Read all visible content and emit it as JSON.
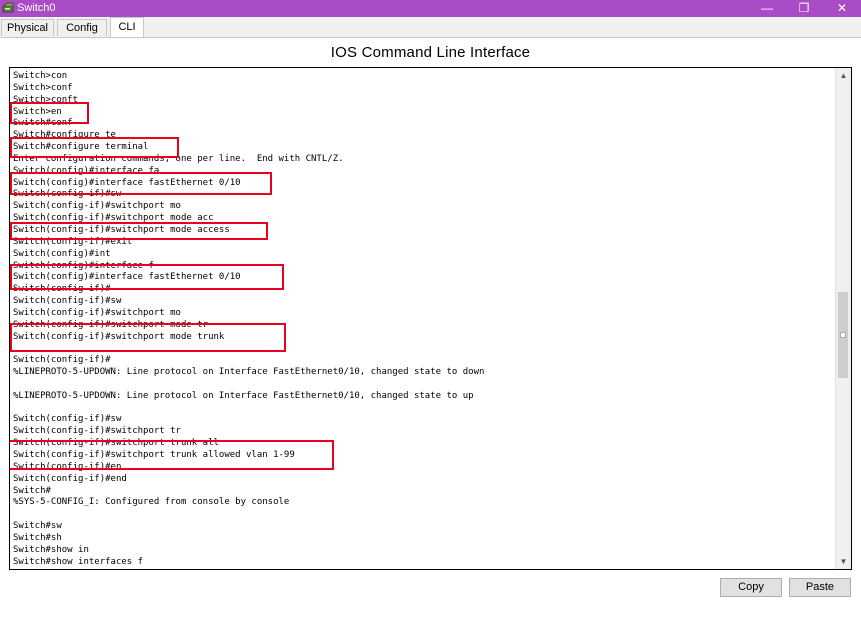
{
  "window": {
    "title": "Switch0",
    "minimize_glyph": "—",
    "maximize_glyph": "❐",
    "close_glyph": "✕",
    "accent": "#aa4cc6"
  },
  "tabs": [
    "Physical",
    "Config",
    "CLI"
  ],
  "active_tab": "CLI",
  "heading": "IOS Command Line Interface",
  "console_lines": [
    "Switch>con",
    "Switch>conf",
    "Switch>conft",
    "Switch>en",
    "Switch#conf",
    "Switch#configure te",
    "Switch#configure terminal",
    "Enter configuration commands, one per line.  End with CNTL/Z.",
    "Switch(config)#interface fa",
    "Switch(config)#interface fastEthernet 0/10",
    "Switch(config-if)#sw",
    "Switch(config-if)#switchport mo",
    "Switch(config-if)#switchport mode acc",
    "Switch(config-if)#switchport mode access",
    "Switch(config-if)#exit",
    "Switch(config)#int",
    "Switch(config)#interface f",
    "Switch(config)#interface fastEthernet 0/10",
    "Switch(config-if)#",
    "Switch(config-if)#sw",
    "Switch(config-if)#switchport mo",
    "Switch(config-if)#switchport mode tr",
    "Switch(config-if)#switchport mode trunk",
    "",
    "Switch(config-if)#",
    "%LINEPROTO-5-UPDOWN: Line protocol on Interface FastEthernet0/10, changed state to down",
    "",
    "%LINEPROTO-5-UPDOWN: Line protocol on Interface FastEthernet0/10, changed state to up",
    "",
    "Switch(config-if)#sw",
    "Switch(config-if)#switchport tr",
    "Switch(config-if)#switchport trunk all",
    "Switch(config-if)#switchport trunk allowed vlan 1-99",
    "Switch(config-if)#en",
    "Switch(config-if)#end",
    "Switch#",
    "%SYS-5-CONFIG_I: Configured from console by console",
    "",
    "Switch#sw",
    "Switch#sh",
    "Switch#show in",
    "Switch#show interfaces f"
  ],
  "scrollbar": {
    "up_glyph": "▲",
    "down_glyph": "▼"
  },
  "buttons": {
    "copy": "Copy",
    "paste": "Paste"
  },
  "highlight_color": "#e8001c"
}
